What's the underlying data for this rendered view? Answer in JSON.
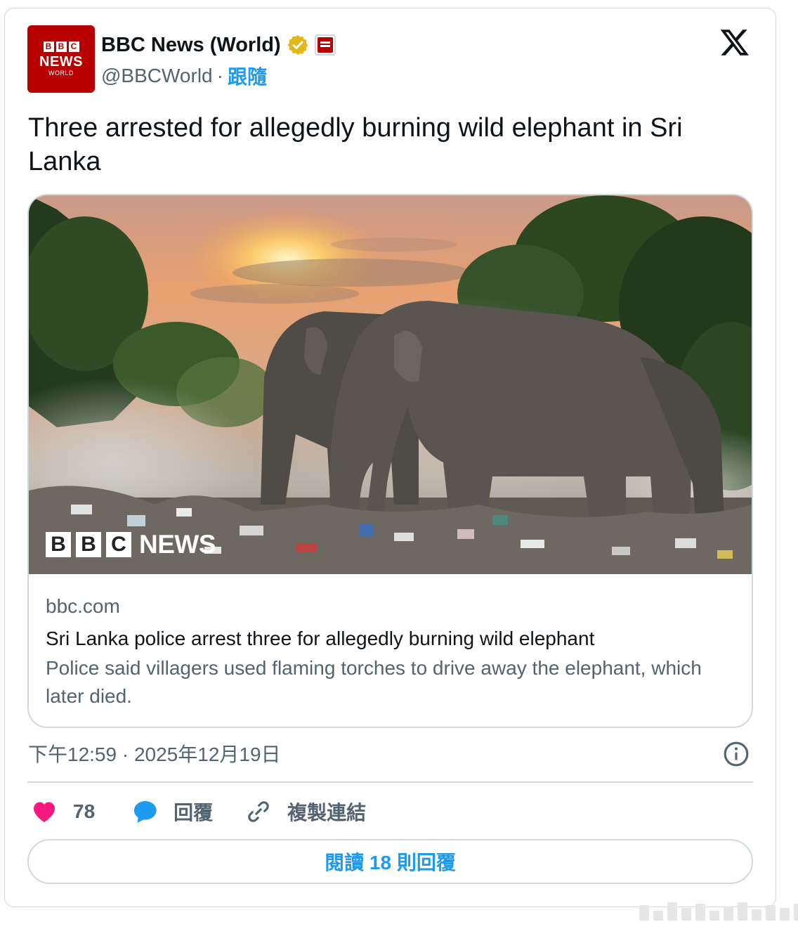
{
  "account": {
    "avatar_blocks": [
      "B",
      "B",
      "C"
    ],
    "avatar_news": "NEWS",
    "avatar_world": "WORLD",
    "display_name": "BBC News (World)",
    "handle": "@BBCWorld",
    "separator": "·",
    "follow_label": "跟隨"
  },
  "tweet": {
    "text": "Three arrested for allegedly burning wild elephant in Sri Lanka"
  },
  "link_card": {
    "photo_logo_blocks": [
      "B",
      "B",
      "C"
    ],
    "photo_logo_text": "NEWS",
    "domain": "bbc.com",
    "title": "Sri Lanka police arrest three for allegedly burning wild elephant",
    "description": "Police said villagers used flaming torches to drive away the elephant, which later died."
  },
  "meta": {
    "timestamp": "下午12:59 · 2025年12月19日"
  },
  "actions": {
    "like_count": "78",
    "reply_label": "回覆",
    "copy_link_label": "複製連結"
  },
  "read_replies_label": "閱讀 18 則回覆",
  "colors": {
    "bbc_red": "#b80000",
    "link_blue": "#1d9bf0",
    "like_pink": "#f91880",
    "secondary_text": "#536471",
    "border": "#cfd9de"
  }
}
